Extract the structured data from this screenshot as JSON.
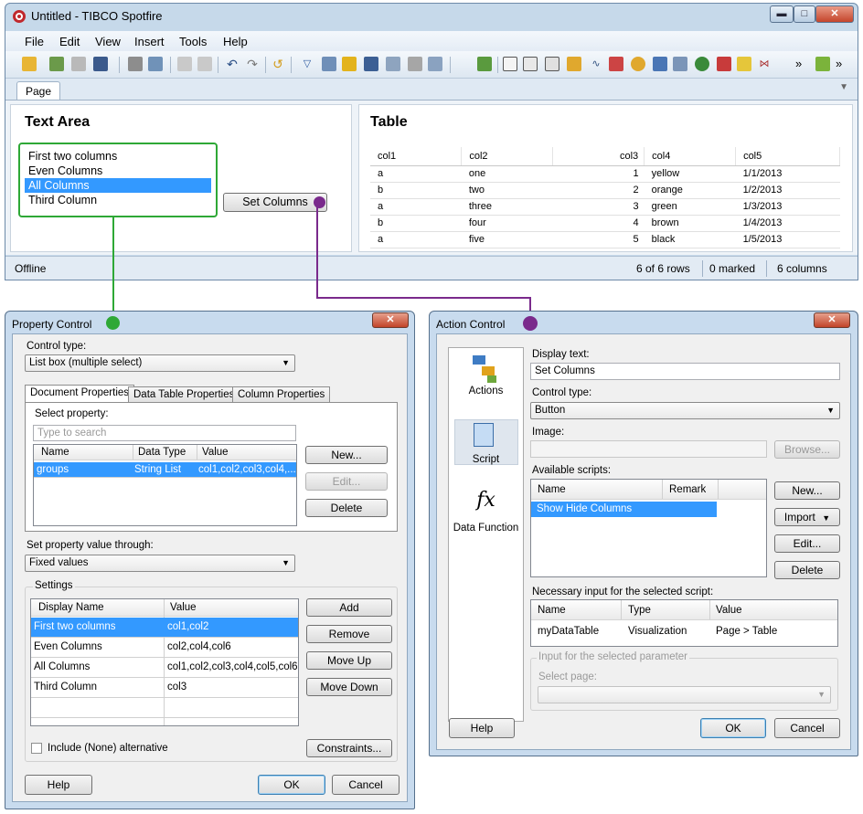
{
  "main_window": {
    "title": "Untitled - TIBCO Spotfire",
    "controls": {
      "minimize": "▬",
      "maximize": "□",
      "close": "✕"
    },
    "menu": [
      "File",
      "Edit",
      "View",
      "Insert",
      "Tools",
      "Help"
    ],
    "overflow_glyph": "»",
    "page_tab": "Page",
    "tab_menu_glyph": "▼",
    "text_area": {
      "title": "Text Area",
      "list_items": [
        "First two columns",
        "Even Columns",
        "All Columns",
        "Third Column"
      ],
      "selected_index": 2,
      "button_label": "Set Columns"
    },
    "table": {
      "title": "Table",
      "headers": [
        "col1",
        "col2",
        "col3",
        "col4",
        "col5"
      ],
      "rows": [
        [
          "a",
          "one",
          "1",
          "yellow",
          "1/1/2013"
        ],
        [
          "b",
          "two",
          "2",
          "orange",
          "1/2/2013"
        ],
        [
          "a",
          "three",
          "3",
          "green",
          "1/3/2013"
        ],
        [
          "b",
          "four",
          "4",
          "brown",
          "1/4/2013"
        ],
        [
          "a",
          "five",
          "5",
          "black",
          "1/5/2013"
        ]
      ]
    },
    "status": {
      "left": "Offline",
      "rows": "6 of 6 rows",
      "marked": "0 marked",
      "columns": "6 columns"
    }
  },
  "property_control": {
    "title": "Property Control",
    "close_label": "✕",
    "control_type_label": "Control type:",
    "control_type_value": "List box (multiple select)",
    "tabs": [
      "Document Properties",
      "Data Table Properties",
      "Column Properties"
    ],
    "active_tab": 0,
    "select_property_label": "Select property:",
    "search_placeholder": "Type to search",
    "property_headers": [
      "Name",
      "Data Type",
      "Value"
    ],
    "property_rows": [
      [
        "groups",
        "String List",
        "col1,col2,col3,col4,..."
      ]
    ],
    "side_buttons": [
      "New...",
      "Edit...",
      "Delete"
    ],
    "set_through_label": "Set property value through:",
    "set_through_value": "Fixed values",
    "settings_label": "Settings",
    "settings_headers": [
      "Display Name",
      "Value"
    ],
    "settings_rows": [
      [
        "First two columns",
        "col1,col2"
      ],
      [
        "Even Columns",
        "col2,col4,col6"
      ],
      [
        "All Columns",
        "col1,col2,col3,col4,col5,col6"
      ],
      [
        "Third Column",
        "col3"
      ]
    ],
    "settings_buttons": [
      "Add",
      "Remove",
      "Move Up",
      "Move Down"
    ],
    "include_none_label": "Include (None) alternative",
    "constraints_label": "Constraints...",
    "help_label": "Help",
    "ok_label": "OK",
    "cancel_label": "Cancel"
  },
  "action_control": {
    "title": "Action Control",
    "close_label": "✕",
    "side_options": [
      "Actions",
      "Script",
      "Data Function"
    ],
    "fx_glyph": "fx",
    "display_text_label": "Display text:",
    "display_text_value": "Set Columns",
    "control_type_label": "Control type:",
    "control_type_value": "Button",
    "image_label": "Image:",
    "browse_label": "Browse...",
    "available_scripts_label": "Available scripts:",
    "scripts_headers": [
      "Name",
      "Remark"
    ],
    "scripts_rows": [
      "Show Hide Columns"
    ],
    "script_buttons": [
      "New...",
      "Import",
      "Edit...",
      "Delete"
    ],
    "necessary_input_label": "Necessary input for the selected script:",
    "input_headers": [
      "Name",
      "Type",
      "Value"
    ],
    "input_rows": [
      [
        "myDataTable",
        "Visualization",
        "Page > Table"
      ]
    ],
    "input_selected_label": "Input for the selected parameter",
    "select_page_label": "Select page:",
    "help_label": "Help",
    "ok_label": "OK",
    "cancel_label": "Cancel"
  },
  "colors": {
    "green_highlight": "#2ea836",
    "purple_highlight": "#7a2a8c",
    "selection": "#3399ff"
  }
}
